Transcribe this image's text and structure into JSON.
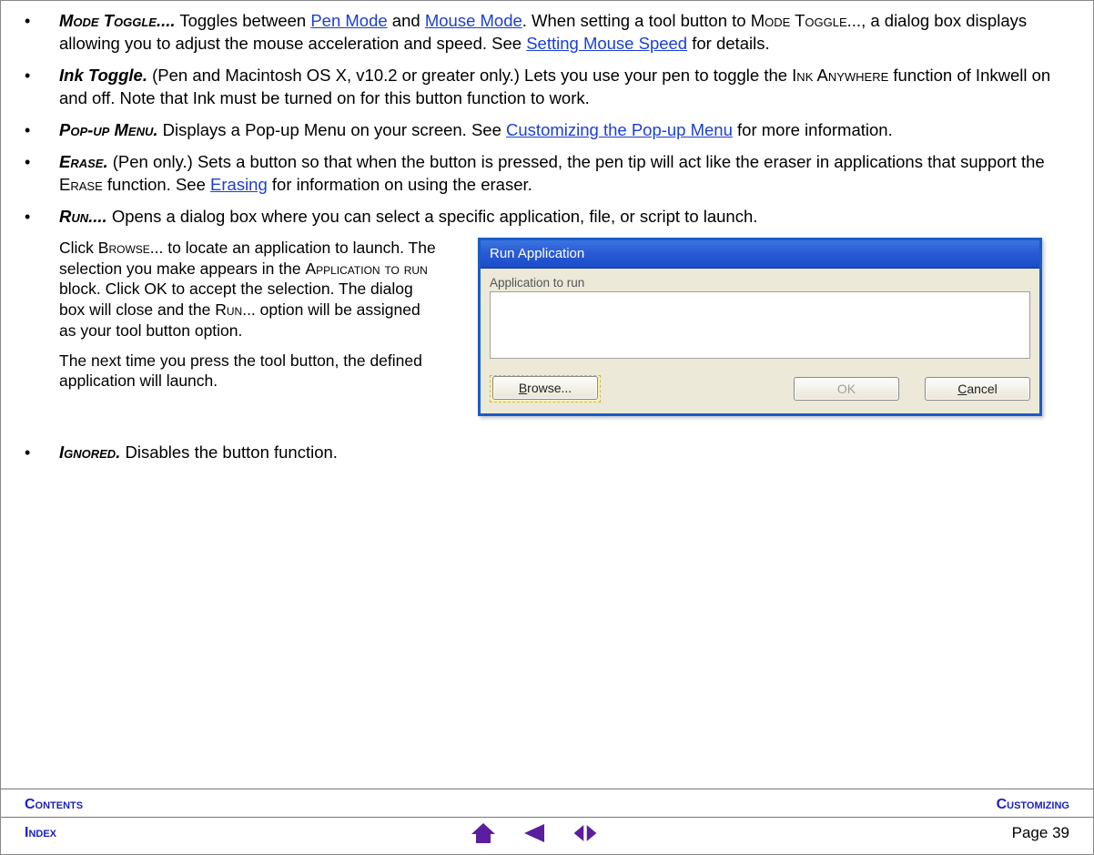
{
  "bullets": {
    "mode_toggle": {
      "term": "Mode Toggle....",
      "pre": "  Toggles between ",
      "link1": "Pen Mode",
      "mid1": " and ",
      "link2": "Mouse Mode",
      "post1": ".  When setting a tool button to ",
      "sc1": "Mode Toggle",
      "post2": "..., a dialog box displays allowing you to adjust the mouse acceleration and speed.  See ",
      "link3": "Setting Mouse Speed",
      "post3": " for details."
    },
    "ink_toggle": {
      "term": "Ink Toggle.",
      "pre": "  (Pen and Macintosh OS X, v10.2 or greater only.)  Lets you use your pen to toggle the ",
      "sc1": "Ink Anywhere",
      "post1": " function of Inkwell on and off.  Note that Ink must be turned on for this button function to work."
    },
    "popup": {
      "term": "Pop-up Menu.",
      "pre": "  Displays a Pop-up Menu on your screen.  See ",
      "link1": "Customizing the Pop-up Menu",
      "post1": " for more information."
    },
    "erase": {
      "term": "Erase.",
      "pre": "  (Pen only.)  Sets a button so that when the button is pressed, the pen tip will act like the eraser in applications that support the ",
      "sc1": "Erase",
      "post1": " function.  See ",
      "link1": "Erasing",
      "post2": " for information on using the eraser."
    },
    "run": {
      "term": "Run....",
      "post": "  Opens a dialog box where you can select a specific application, file, or script to launch."
    },
    "ignored": {
      "term": "Ignored.",
      "post": "  Disables the button function."
    }
  },
  "run_block": {
    "p1_a": "Click ",
    "p1_sc1": "Browse",
    "p1_b": "... to locate an application to launch.  The selection you make appears in the ",
    "p1_sc2": "Application to run",
    "p1_c": " block.  Click OK to accept the selection.  The dialog box will close and the ",
    "p1_sc3": "Run",
    "p1_d": "... option will be assigned as your tool button option.",
    "p2": "The next time you press the tool button, the defined application will launch."
  },
  "dialog": {
    "title": "Run Application",
    "label": "Application to run",
    "browse_u": "B",
    "browse_rest": "rowse...",
    "ok": "OK",
    "cancel_u": "C",
    "cancel_rest": "ancel"
  },
  "footer": {
    "contents": "Contents",
    "customizing": "Customizing",
    "index": "Index",
    "page_label": "Page  ",
    "page_num": "39"
  }
}
